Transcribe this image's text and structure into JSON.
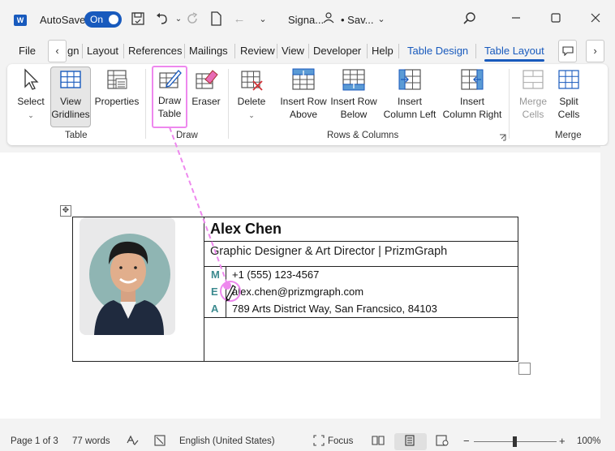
{
  "titlebar": {
    "app_logo": "W",
    "autosave_label": "AutoSave",
    "autosave_state": "On",
    "doc_title": "Signa...",
    "save_status": "• Sav...",
    "icons": [
      "save-icon",
      "undo-icon",
      "redo-icon",
      "new-doc-icon",
      "back-icon",
      "customize-icon",
      "person-icon",
      "chevron-down-icon",
      "search-icon",
      "minimize-icon",
      "maximize-icon",
      "close-icon"
    ]
  },
  "tabs": {
    "items": [
      "File",
      "gn",
      "Layout",
      "References",
      "Mailings",
      "Review",
      "View",
      "Developer",
      "Help",
      "Table Design",
      "Table Layout"
    ],
    "active": "Table Layout",
    "scroll_left": "‹",
    "scroll_right": "›"
  },
  "ribbon": {
    "table_group": {
      "label": "Table",
      "select": "Select",
      "view_gridlines_1": "View",
      "view_gridlines_2": "Gridlines",
      "properties": "Properties"
    },
    "draw_group": {
      "label": "Draw",
      "draw_table_1": "Draw",
      "draw_table_2": "Table",
      "eraser": "Eraser"
    },
    "rows_cols_group": {
      "label": "Rows & Columns",
      "delete": "Delete",
      "insert_row_above_1": "Insert Row",
      "insert_row_above_2": "Above",
      "insert_row_below_1": "Insert Row",
      "insert_row_below_2": "Below",
      "insert_col_left_1": "Insert",
      "insert_col_left_2": "Column Left",
      "insert_col_right_1": "Insert",
      "insert_col_right_2": "Column Right"
    },
    "merge_group": {
      "label": "Merge",
      "merge_cells_1": "Merge",
      "merge_cells_2": "Cells",
      "split_cells_1": "Split",
      "split_cells_2": "Cells"
    }
  },
  "signature": {
    "name": "Alex Chen",
    "title": "Graphic Designer & Art Director | PrizmGraph",
    "contacts": [
      {
        "label": "M",
        "value": "+1 (555) 123-4567"
      },
      {
        "label": "E",
        "value": "alex.chen@prizmgraph.com"
      },
      {
        "label": "A",
        "value": "789 Arts District Way, San Francsico, 84103"
      }
    ]
  },
  "status": {
    "page": "Page 1 of 3",
    "words": "77 words",
    "language": "English (United States)",
    "focus": "Focus",
    "zoom": "100%",
    "zoom_out": "−",
    "zoom_in": "+",
    "zoom_level": 1.0
  },
  "colors": {
    "accent": "#185abd",
    "highlight": "#ee88ee",
    "contact_label": "#3c8a8f"
  }
}
